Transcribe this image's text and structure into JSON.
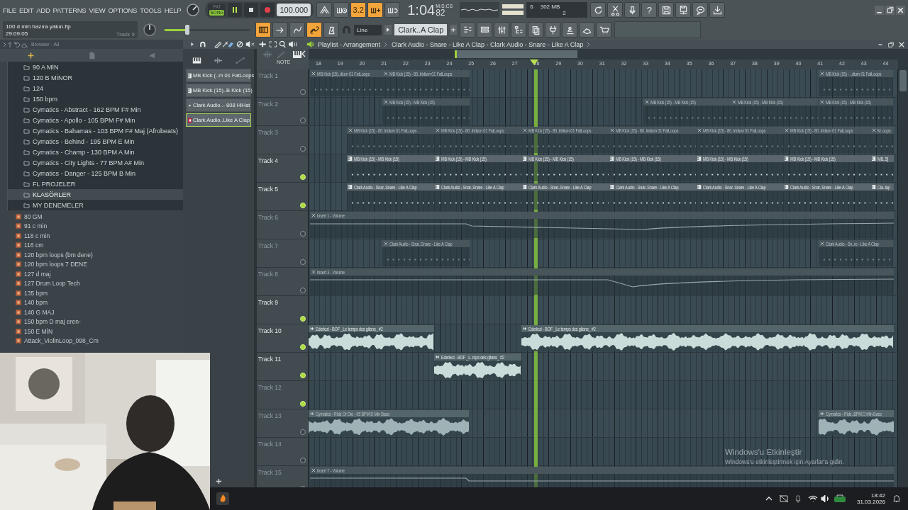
{
  "menu": [
    "FILE",
    "EDIT",
    "ADD",
    "PATTERNS",
    "VIEW",
    "OPTIONS",
    "TOOLS",
    "HELP"
  ],
  "transport": {
    "pat_label": "PAT",
    "song_label": "SONG",
    "song_mode": true,
    "playing": true,
    "tempo": "100.000"
  },
  "time": {
    "unit": "M:S:CS",
    "value": "1:04",
    "centis": "82"
  },
  "project": {
    "file": "100 d min hazıra yakın.flp",
    "duration": "29:09:05",
    "hint": "Track 9"
  },
  "cpu": {
    "cpu": "6",
    "memory": "302 MB",
    "polyphony": "2"
  },
  "main_volume": {
    "level": 0.27
  },
  "tools_row1": [
    {
      "on": false
    },
    {
      "on": false
    },
    {
      "on": true,
      "label": "3.2"
    },
    {
      "on": true
    },
    {
      "on": false
    }
  ],
  "help_label": "?",
  "tools_row2": [
    {
      "on": true
    },
    {
      "on": false
    },
    {
      "on": false
    },
    {
      "on": true
    },
    {
      "on": false
    }
  ],
  "snap": "Line",
  "pattern": "Clark..A Clap",
  "browser": {
    "title": "Browser - All",
    "folders": [
      {
        "label": "90 A MİN",
        "selected": false
      },
      {
        "label": "120 B MİNOR",
        "selected": false
      },
      {
        "label": "124",
        "selected": false
      },
      {
        "label": "150 bpm",
        "selected": false
      },
      {
        "label": "Cymatics - Abstract - 162 BPM F# Min",
        "selected": false
      },
      {
        "label": "Cymatics - Apollo - 105 BPM F# Min",
        "selected": false
      },
      {
        "label": "Cymatics - Bahamas - 103 BPM F# Maj (Afrobeats)",
        "selected": false
      },
      {
        "label": "Cymatics - Behind - 195 BPM E Min",
        "selected": false
      },
      {
        "label": "Cymatics - Champ - 130 BPM A Min",
        "selected": false
      },
      {
        "label": "Cymatics - City Lights - 77 BPM A# Min",
        "selected": false
      },
      {
        "label": "Cymatics - Danger - 125 BPM B Min",
        "selected": false
      },
      {
        "label": "FL PROJELER",
        "selected": false
      },
      {
        "label": "KLASÖRLER",
        "selected": true
      },
      {
        "label": "MY DENEMELER",
        "selected": false
      }
    ],
    "files": [
      "80 GM",
      "91 c min",
      "118 c min",
      "118 cm",
      "120 bpm loops (bm dene)",
      "120 bpm loops 7 DENE",
      "127 d maj",
      "127 Drum Loop Tech",
      "135 bpm",
      "140 bpm",
      "140 G MAJ",
      "150 bpm D maj eren-",
      "150 E MİN",
      "Attack_ViolinLoop_098_Cm"
    ]
  },
  "channels": [
    {
      "label": "MB Kick (..m 01 FatLoops",
      "kind": "pattern",
      "selected": false
    },
    {
      "label": "MB Kick (15)..B Kick (15)",
      "kind": "pattern",
      "selected": false
    },
    {
      "label": "Clark Audio..- 808 HiHat",
      "kind": "dot",
      "selected": false
    },
    {
      "label": "Clark Audio..Like A Clap",
      "kind": "pin",
      "selected": true
    }
  ],
  "playlist": {
    "title": "Playlist - Arrangement",
    "pattern_path": "Clark Audio - Snare - Like A Clap - Clark Audio - Snare - Like A Clap",
    "header_label": "NOTE",
    "ruler": [
      "18",
      "19",
      "20",
      "21",
      "22",
      "23",
      "24",
      "25",
      "26",
      "27",
      "28",
      "29",
      "30",
      "31",
      "32",
      "33",
      "34",
      "35",
      "36",
      "37",
      "38",
      "39",
      "40",
      "41",
      "42",
      "43",
      "44"
    ],
    "tracks": [
      {
        "name": "Track 1",
        "enabled": false,
        "led_on": false,
        "clips": [
          {
            "kind": "pattern",
            "label": "MB Kick (15)..dium 01 FatLoops"
          },
          {
            "kind": "pattern",
            "label": "MB Kick (15) - 80..Iridium 01 FatLoops"
          },
          {
            "kind": "pattern",
            "label": "MB Kick (15) - ..dium 01 FatLoops"
          }
        ]
      },
      {
        "name": "Track 2",
        "enabled": false,
        "led_on": false,
        "clips": [
          {
            "kind": "pattern",
            "label": "MB Kick (15) - MB Kick (15)"
          },
          {
            "kind": "pattern",
            "label": "MB Kick (15) - MB Kick (15)"
          },
          {
            "kind": "pattern",
            "label": "MB Kick (15) - MB Kick (15)"
          },
          {
            "kind": "pattern",
            "label": "MB Kick (15) - MB Kick (15)"
          }
        ]
      },
      {
        "name": "Track 3",
        "enabled": false,
        "led_on": false,
        "clips": [
          {
            "kind": "pattern",
            "label": "MB Kick (15) - 80..Iridium 01 FatLoops"
          },
          {
            "kind": "pattern",
            "label": "MB Kick (15) - 80..Iridium 01 FatLoops"
          },
          {
            "kind": "pattern",
            "label": "MB Kick (15) - 80..Iridium 01 FatLoops"
          },
          {
            "kind": "pattern",
            "label": "MB Kick (15) - 80..Iridium 01 FatLoops"
          },
          {
            "kind": "pattern",
            "label": "MB Kick (15) - 80..Iridium 01 FatLoops"
          },
          {
            "kind": "pattern",
            "label": "MB Kick (15) - 80..Iridium 01 FatLoops"
          },
          {
            "kind": "pattern",
            "label": "M..oops"
          }
        ]
      },
      {
        "name": "Track 4",
        "enabled": true,
        "led_on": true,
        "clips": [
          {
            "kind": "pattern",
            "label": "MB Kick (15) - MB Kick (15)"
          },
          {
            "kind": "pattern",
            "label": "MB Kick (15) - MB Kick (15)"
          },
          {
            "kind": "pattern",
            "label": "MB Kick (15) - MB Kick (15)"
          },
          {
            "kind": "pattern",
            "label": "MB Kick (15) - MB Kick (15)"
          },
          {
            "kind": "pattern",
            "label": "MB Kick (15) - MB Kick (15)"
          },
          {
            "kind": "pattern",
            "label": "MB Kick (15) - MB Kick (15)"
          },
          {
            "kind": "pattern",
            "label": "MB..5]"
          }
        ]
      },
      {
        "name": "Track 5",
        "enabled": true,
        "led_on": true,
        "clips": [
          {
            "kind": "pattern",
            "label": "Clark Audio - Snar..Snare - Like A Clap"
          },
          {
            "kind": "pattern",
            "label": "Clark Audio - Snar..Snare - Like A Clap"
          },
          {
            "kind": "pattern",
            "label": "Clark Audio - Snar..Snare - Like A Clap"
          },
          {
            "kind": "pattern",
            "label": "Clark Audio - Snar..Snare - Like A Clap"
          },
          {
            "kind": "pattern",
            "label": "Clark Audio - Snar..Snare - Like A Clap"
          },
          {
            "kind": "pattern",
            "label": "Clark Audio - Snar..Snare - Like A Clap"
          },
          {
            "kind": "pattern",
            "label": "Cla..lap"
          }
        ]
      },
      {
        "name": "Track 6",
        "enabled": false,
        "led_on": false,
        "clips": [
          {
            "kind": "automation",
            "label": "Insert 1 - Volume"
          }
        ]
      },
      {
        "name": "Track 7",
        "enabled": false,
        "led_on": false,
        "clips": [
          {
            "kind": "pattern",
            "label": "Clark Audio - Snar..Snare - Like A Clap"
          },
          {
            "kind": "pattern",
            "label": "Clark Audio - Sn..re - Like A Clap"
          }
        ]
      },
      {
        "name": "Track 8",
        "enabled": false,
        "led_on": false,
        "clips": [
          {
            "kind": "automation",
            "label": "Insert 3 - Volume"
          }
        ]
      },
      {
        "name": "Track 9",
        "enabled": true,
        "led_on": true
      },
      {
        "name": "Track 10",
        "enabled": true,
        "led_on": true,
        "clips": [
          {
            "kind": "audio",
            "label": "Ederlezi - BOF _Le temps des gitans_ #2"
          },
          {
            "kind": "audio",
            "label": "Ederlezi - BOF _Le temps des gitans_ #2"
          }
        ]
      },
      {
        "name": "Track 11",
        "enabled": true,
        "led_on": true,
        "clips": [
          {
            "kind": "audio",
            "label": "Ederlezi - BOF _L..mps des gitans_ #2"
          }
        ]
      },
      {
        "name": "Track 12",
        "enabled": false,
        "led_on": true
      },
      {
        "name": "Track 13",
        "enabled": false,
        "led_on": false,
        "clips": [
          {
            "kind": "audio",
            "label": "Cymatics - Ride Or Die - 95 BPM D Min Bass"
          },
          {
            "kind": "audio",
            "label": "Cymatics - Ride..BPM D Min Bass"
          }
        ]
      },
      {
        "name": "Track 14",
        "enabled": false,
        "led_on": false
      },
      {
        "name": "Track 15",
        "enabled": false,
        "led_on": false,
        "clips": [
          {
            "kind": "automation",
            "label": "Insert 7 - Volume"
          }
        ]
      }
    ]
  },
  "windows_notice": {
    "title": "Windows'u Etkinleştir",
    "message": "Windows'u etkinleştirmek için Ayarlar'a gidin."
  },
  "taskbar": {
    "time": "18:42",
    "date": "31.03.2026"
  }
}
